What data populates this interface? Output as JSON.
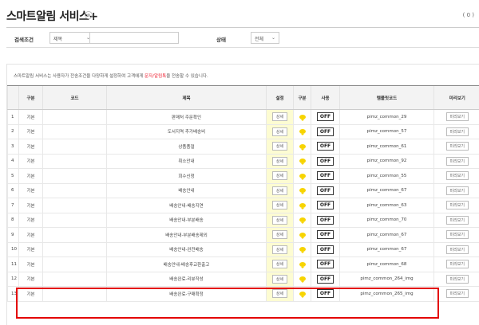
{
  "header": {
    "title": "스마트알림 서비스+",
    "count": "( 0 )"
  },
  "search": {
    "condition_label": "검색조건",
    "condition_value": "제목",
    "keyword_value": "",
    "status_label": "상태",
    "status_value": "전체"
  },
  "notice": {
    "before": "스마트알림 서비스는 사용자가 전송조건을 다양하게 설정하여 고객에게 ",
    "highlight": "문자/알림톡",
    "after": "을 전송할 수 있습니다."
  },
  "columns": {
    "type": "구분",
    "code": "코드",
    "subject": "제목",
    "setting": "설정",
    "kind": "구분",
    "use": "사용",
    "template": "템플릿코드",
    "preview": "미리보기"
  },
  "labels": {
    "detail": "상세",
    "off": "OFF",
    "preview": "미리보기"
  },
  "rows": [
    {
      "no": "1",
      "type": "기본",
      "code": "",
      "subject": "판매처 주문확인",
      "use": "OFF",
      "template": "pimz_common_29"
    },
    {
      "no": "2",
      "type": "기본",
      "code": "",
      "subject": "도서지역 추가배송비",
      "use": "OFF",
      "template": "pimz_common_57"
    },
    {
      "no": "3",
      "type": "기본",
      "code": "",
      "subject": "상품품절",
      "use": "OFF",
      "template": "pimz_common_61"
    },
    {
      "no": "4",
      "type": "기본",
      "code": "",
      "subject": "취소안내",
      "use": "OFF",
      "template": "pimz_common_92"
    },
    {
      "no": "5",
      "type": "기본",
      "code": "",
      "subject": "회수신청",
      "use": "OFF",
      "template": "pimz_common_55"
    },
    {
      "no": "6",
      "type": "기본",
      "code": "",
      "subject": "배송안내",
      "use": "OFF",
      "template": "pimz_common_67"
    },
    {
      "no": "7",
      "type": "기본",
      "code": "",
      "subject": "배송안내-배송지연",
      "use": "OFF",
      "template": "pimz_common_63"
    },
    {
      "no": "8",
      "type": "기본",
      "code": "",
      "subject": "배송안내-부분배송",
      "use": "OFF",
      "template": "pimz_common_70"
    },
    {
      "no": "9",
      "type": "기본",
      "code": "",
      "subject": "배송안내-부분배송제외",
      "use": "OFF",
      "template": "pimz_common_67"
    },
    {
      "no": "10",
      "type": "기본",
      "code": "",
      "subject": "배송안내-완전배송",
      "use": "OFF",
      "template": "pimz_common_67"
    },
    {
      "no": "11",
      "type": "기본",
      "code": "",
      "subject": "배송안내-배송후교환출고",
      "use": "OFF",
      "template": "pimz_common_68"
    },
    {
      "no": "12",
      "type": "기본",
      "code": "",
      "subject": "배송완료-리뷰작성",
      "use": "OFF",
      "template": "pimz_common_264_img"
    },
    {
      "no": "13",
      "type": "기본",
      "code": "",
      "subject": "배송완료-구매확정",
      "use": "OFF",
      "template": "pimz_common_265_img"
    }
  ],
  "colors": {
    "highlight_border": "#e30000",
    "kakao": "#f7d400",
    "setting_bg": "#fdfcd2"
  }
}
